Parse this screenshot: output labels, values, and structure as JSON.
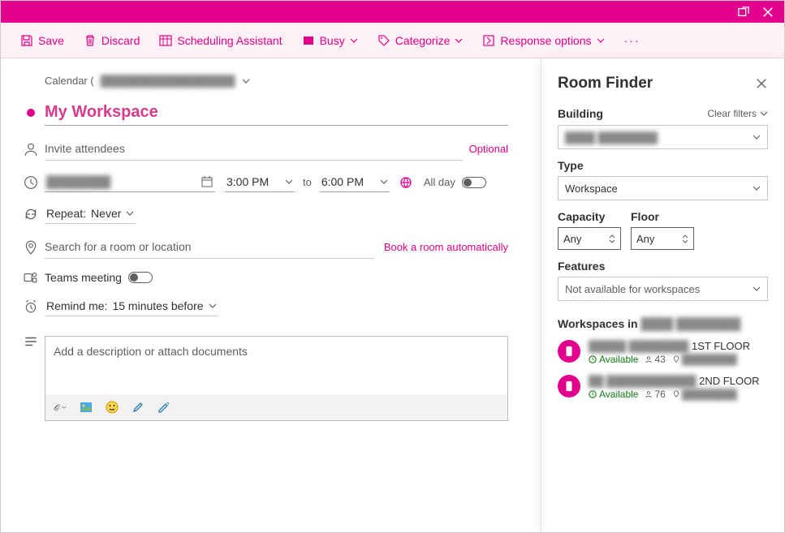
{
  "toolbar": {
    "save": "Save",
    "discard": "Discard",
    "scheduling": "Scheduling Assistant",
    "busy": "Busy",
    "categorize": "Categorize",
    "response": "Response options"
  },
  "breadcrumb": {
    "label": "Calendar (",
    "redacted": "██████████████████"
  },
  "event": {
    "title": "My Workspace",
    "attendees_placeholder": "Invite attendees",
    "optional": "Optional",
    "date_redacted": "████████",
    "time_start": "3:00 PM",
    "time_to": "to",
    "time_end": "6:00 PM",
    "allday": "All day",
    "repeat_label": "Repeat:",
    "repeat_value": "Never",
    "location_placeholder": "Search for a room or location",
    "location_link": "Book a room automatically",
    "teams": "Teams meeting",
    "reminder_label": "Remind me:",
    "reminder_value": "15 minutes before",
    "description_placeholder": "Add a description or attach documents"
  },
  "roomfinder": {
    "title": "Room Finder",
    "building_label": "Building",
    "clear": "Clear filters",
    "building_value": "████ ████████",
    "type_label": "Type",
    "type_value": "Workspace",
    "capacity_label": "Capacity",
    "capacity_value": "Any",
    "floor_label": "Floor",
    "floor_value": "Any",
    "features_label": "Features",
    "features_value": "Not available for workspaces",
    "list_title_prefix": "Workspaces in",
    "list_title_blur": "████ ████████",
    "items": [
      {
        "name_blur": "█████ ████████",
        "name_suffix": "1ST FLOOR",
        "status": "Available",
        "capacity": "43",
        "loc_blur": "████████"
      },
      {
        "name_blur": "██ ████████████",
        "name_suffix": "2ND FLOOR",
        "status": "Available",
        "capacity": "76",
        "loc_blur": "████████"
      }
    ]
  }
}
